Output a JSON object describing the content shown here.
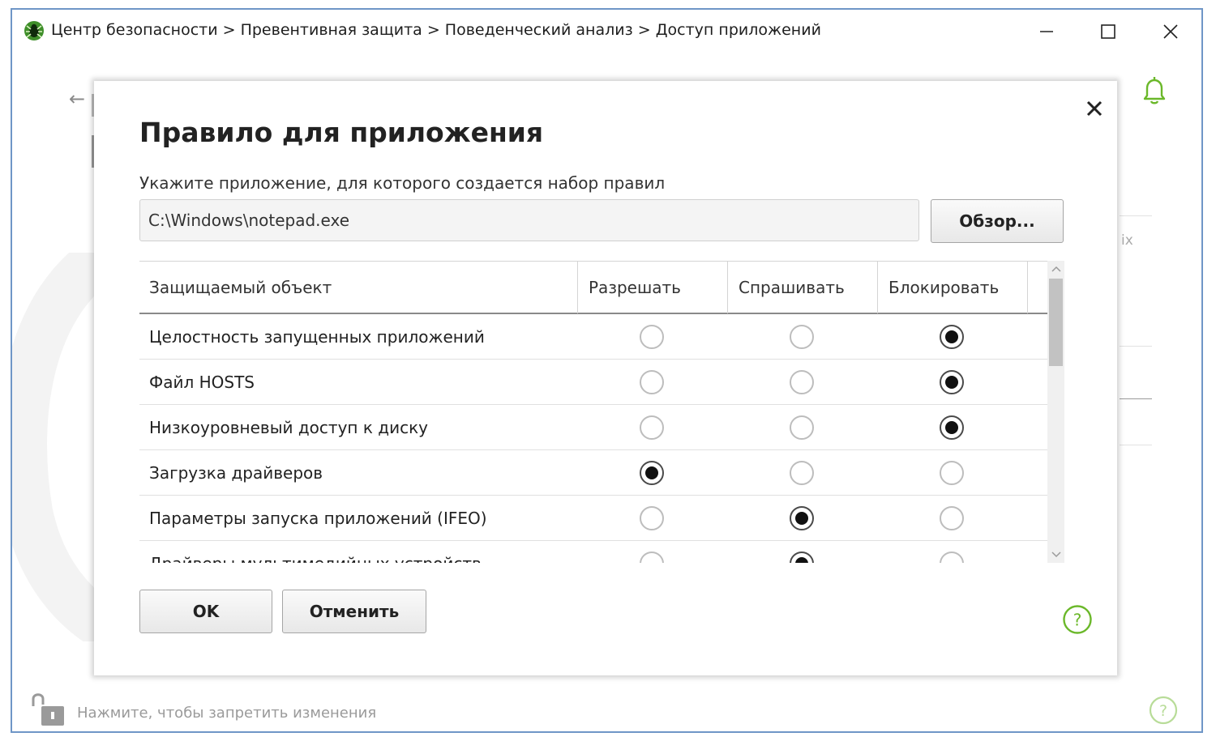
{
  "window": {
    "title": "Центр безопасности > Превентивная защита > Поведенческий анализ > Доступ приложений",
    "icons": [
      "dr-web-spider-icon",
      "minimize-icon",
      "maximize-icon",
      "close-icon"
    ]
  },
  "background": {
    "partial_text": "іх",
    "lock_text": "Нажмите, чтобы запретить изменения"
  },
  "dialog": {
    "title": "Правило для приложения",
    "subtitle": "Укажите приложение, для которого создается набор правил",
    "path_value": "C:\\Windows\\notepad.exe",
    "browse_label": "Обзор...",
    "ok_label": "OK",
    "cancel_label": "Отменить",
    "table": {
      "headers": [
        "Защищаемый объект",
        "Разрешать",
        "Спрашивать",
        "Блокировать"
      ],
      "rows": [
        {
          "label": "Целостность запущенных приложений",
          "selected": "block"
        },
        {
          "label": "Файл HOSTS",
          "selected": "block"
        },
        {
          "label": "Низкоуровневый доступ к диску",
          "selected": "block"
        },
        {
          "label": "Загрузка драйверов",
          "selected": "allow"
        },
        {
          "label": "Параметры запуска приложений (IFEO)",
          "selected": "ask"
        },
        {
          "label": "Драйверы мультимедийных устройств",
          "selected": "ask"
        }
      ]
    }
  },
  "colors": {
    "accent_green": "#6bb82a",
    "window_border": "#6f96c7"
  }
}
